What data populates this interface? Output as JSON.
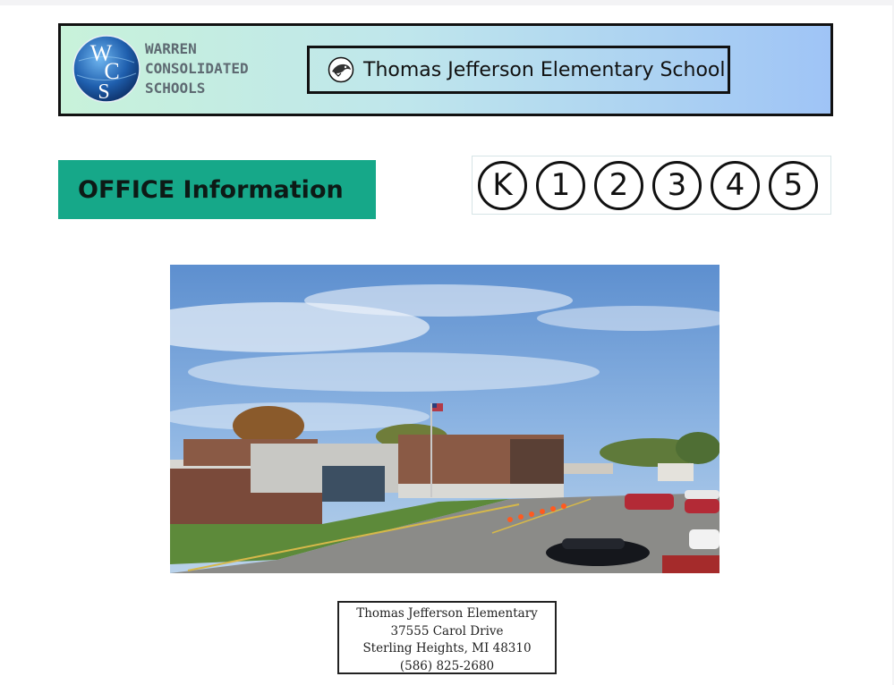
{
  "header": {
    "district_logo_letters": [
      "W",
      "C",
      "S"
    ],
    "district_name_lines": [
      "WARREN",
      "CONSOLIDATED",
      "SCHOOLS"
    ],
    "school_name": "Thomas Jefferson Elementary School",
    "school_icon": "school-mascot-icon"
  },
  "section": {
    "title": "OFFICE Information"
  },
  "grades": [
    "K",
    "1",
    "2",
    "3",
    "4",
    "5"
  ],
  "photo": {
    "subject": "school-building-photo"
  },
  "address": {
    "lines": [
      "Thomas Jefferson Elementary",
      "37555 Carol Drive",
      "Sterling Heights, MI 48310",
      "(586) 825-2680"
    ]
  },
  "colors": {
    "office_pill": "#16a889",
    "banner_start": "#c8f2da",
    "banner_end": "#9fc4f6",
    "logo_blue": "#1f5fae"
  }
}
